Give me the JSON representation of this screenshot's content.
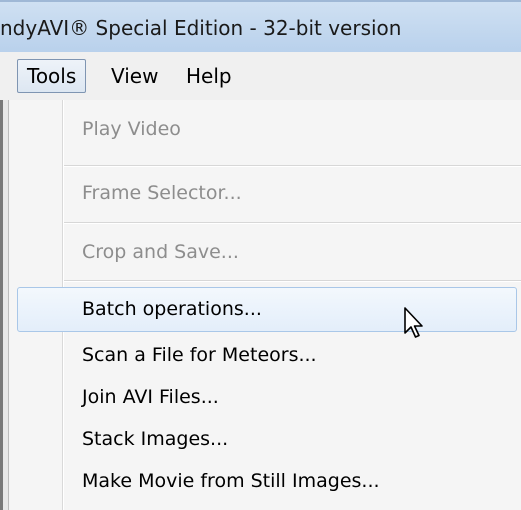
{
  "window": {
    "title": "ndyAVI® Special Edition - 32-bit version"
  },
  "menubar": {
    "items": [
      {
        "label": "Tools",
        "active": true
      },
      {
        "label": "View",
        "active": false
      },
      {
        "label": "Help",
        "active": false
      }
    ]
  },
  "tools_menu": {
    "items": [
      {
        "label": "Play Video",
        "enabled": false
      },
      {
        "label": "Frame Selector...",
        "enabled": false
      },
      {
        "label": "Crop and Save...",
        "enabled": false
      },
      {
        "label": "Batch operations...",
        "enabled": true,
        "highlighted": true
      },
      {
        "label": "Scan a File for Meteors...",
        "enabled": true
      },
      {
        "label": "Join AVI Files...",
        "enabled": true
      },
      {
        "label": "Stack Images...",
        "enabled": true
      },
      {
        "label": "Make Movie from Still Images...",
        "enabled": true
      }
    ]
  },
  "colors": {
    "disabled_text": "#8d8d8d",
    "hover_border": "#a9c7e8"
  },
  "icons": {
    "cursor": "arrow-cursor-icon"
  }
}
